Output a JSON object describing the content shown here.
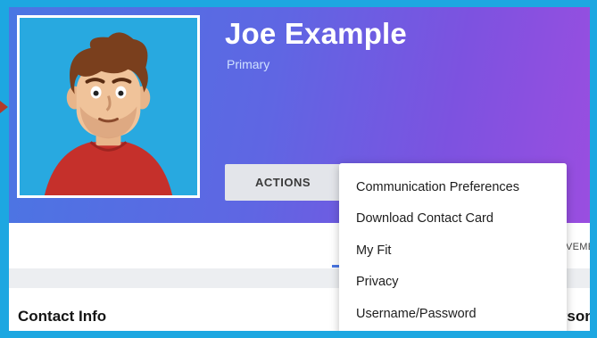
{
  "profile": {
    "name": "Joe Example",
    "subtitle": "Primary"
  },
  "actions": {
    "button_label": "ACTIONS",
    "menu_items": [
      "Communication Preferences",
      "Download Contact Card",
      "My Fit",
      "Privacy",
      "Username/Password"
    ]
  },
  "tabs": {
    "partial_label": "VEME"
  },
  "sections": {
    "contact_info": "Contact Info",
    "right_partial": "Personal"
  },
  "colors": {
    "frame": "#1da7e1",
    "hero_start": "#4a76e3",
    "hero_end": "#9a4ee0",
    "avatar_bg": "#28a9e0"
  },
  "icons": {
    "avatar": "cartoon-man-avatar"
  }
}
